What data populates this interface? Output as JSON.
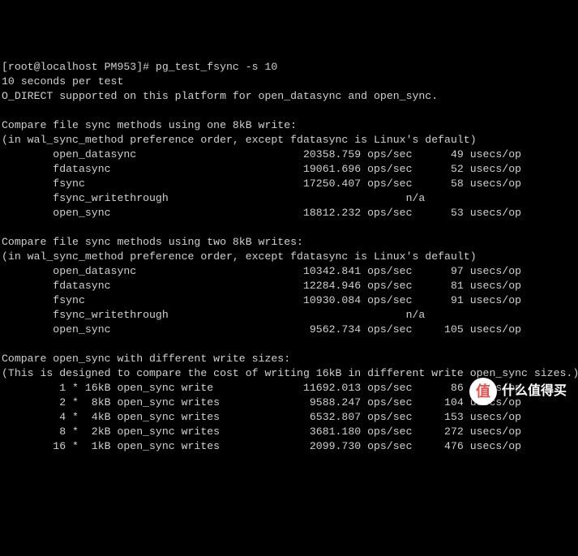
{
  "prompt": {
    "user": "root",
    "host": "localhost",
    "dir": "PM953",
    "symbol": "#",
    "command": "pg_test_fsync -s 10"
  },
  "header": {
    "line1": "10 seconds per test",
    "line2": "O_DIRECT supported on this platform for open_datasync and open_sync."
  },
  "section1": {
    "title": "Compare file sync methods using one 8kB write:",
    "note": "(in wal_sync_method preference order, except fdatasync is Linux's default)",
    "rows": [
      {
        "method": "open_datasync",
        "ops": "20358.759",
        "usecs": "49"
      },
      {
        "method": "fdatasync",
        "ops": "19061.696",
        "usecs": "52"
      },
      {
        "method": "fsync",
        "ops": "17250.407",
        "usecs": "58"
      },
      {
        "method": "fsync_writethrough",
        "na": "n/a"
      },
      {
        "method": "open_sync",
        "ops": "18812.232",
        "usecs": "53"
      }
    ]
  },
  "section2": {
    "title": "Compare file sync methods using two 8kB writes:",
    "note": "(in wal_sync_method preference order, except fdatasync is Linux's default)",
    "rows": [
      {
        "method": "open_datasync",
        "ops": "10342.841",
        "usecs": "97"
      },
      {
        "method": "fdatasync",
        "ops": "12284.946",
        "usecs": "81"
      },
      {
        "method": "fsync",
        "ops": "10930.084",
        "usecs": "91"
      },
      {
        "method": "fsync_writethrough",
        "na": "n/a"
      },
      {
        "method": "open_sync",
        "ops": "9562.734",
        "usecs": "105"
      }
    ]
  },
  "section3": {
    "title": "Compare open_sync with different write sizes:",
    "note": "(This is designed to compare the cost of writing 16kB in different write open_sync sizes.)",
    "rows": [
      {
        "method": " 1 * 16kB open_sync write ",
        "ops": "11692.013",
        "usecs": "86"
      },
      {
        "method": " 2 *  8kB open_sync writes",
        "ops": "9588.247",
        "usecs": "104"
      },
      {
        "method": " 4 *  4kB open_sync writes",
        "ops": "6532.807",
        "usecs": "153"
      },
      {
        "method": " 8 *  2kB open_sync writes",
        "ops": "3681.180",
        "usecs": "272"
      },
      {
        "method": "16 *  1kB open_sync writes",
        "ops": "2099.730",
        "usecs": "476"
      }
    ]
  },
  "units": {
    "ops": "ops/sec",
    "usecs": "usecs/op"
  },
  "watermark": {
    "zhi": "值",
    "text": "什么值得买"
  }
}
